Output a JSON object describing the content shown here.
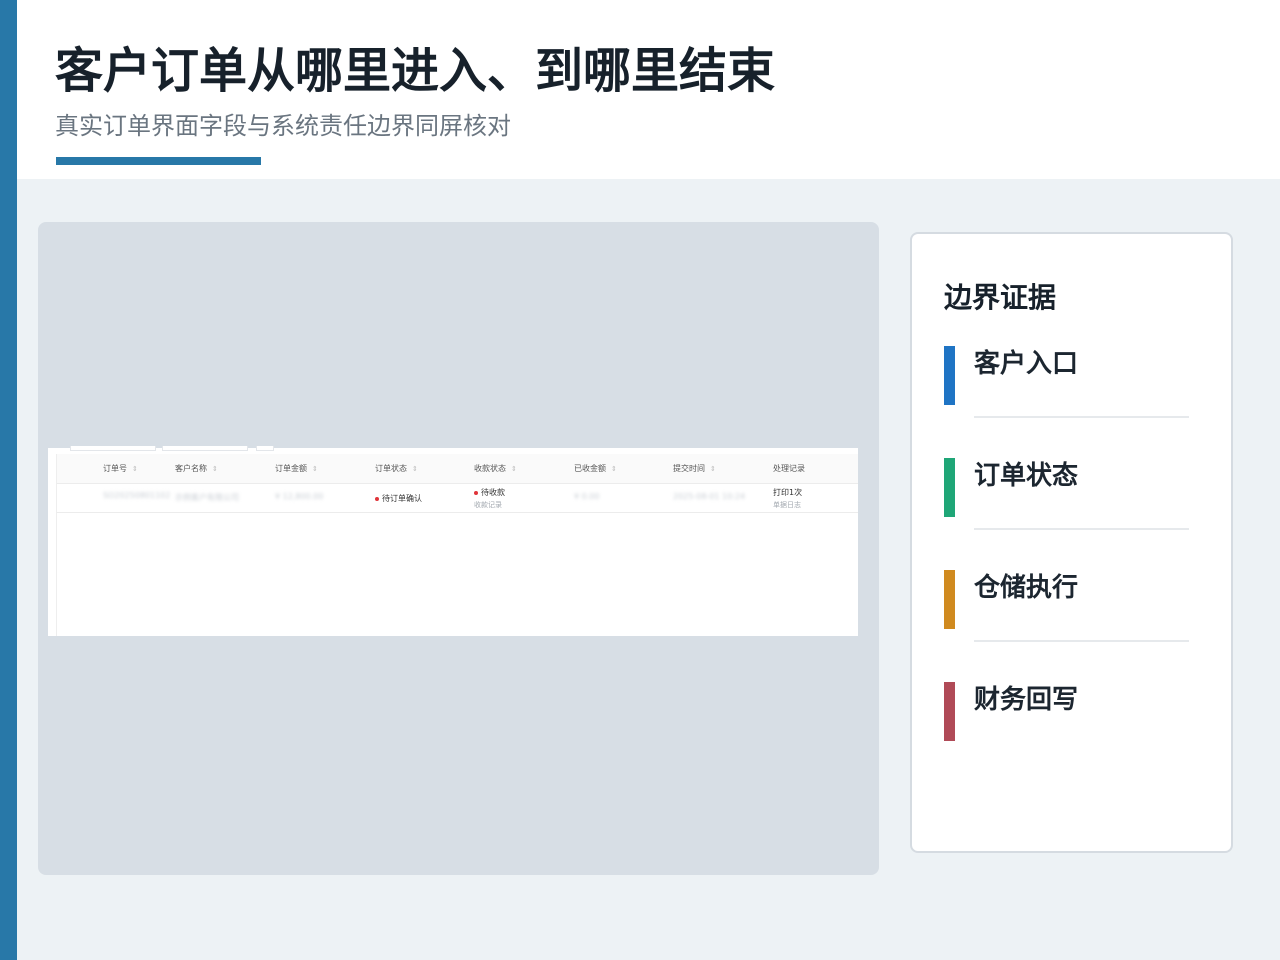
{
  "header": {
    "title": "客户订单从哪里进入、到哪里结束",
    "subtitle": "真实订单界面字段与系统责任边界同屏核对"
  },
  "colors": {
    "brand": "#2878a8",
    "entry": "#1f74c4",
    "status": "#1fa677",
    "warehouse": "#d08a1f",
    "finance": "#b04a57"
  },
  "table": {
    "columns": [
      "订单号",
      "客户名称",
      "订单金额",
      "订单状态",
      "收款状态",
      "已收金额",
      "提交时间",
      "处理记录"
    ],
    "row": {
      "order_no": "SO20250801102",
      "customer": "示例客户有限公司",
      "amount": "¥ 12,800.00",
      "order_status": "待订单确认",
      "payment_status": "待收款",
      "payment_link": "收款记录",
      "received": "¥ 0.00",
      "submitted": "2025-08-01 10:24",
      "records": "打印1次",
      "records_link": "单据日志"
    }
  },
  "evidence": {
    "title": "边界证据",
    "items": [
      {
        "label": "客户入口",
        "color": "#1f74c4"
      },
      {
        "label": "订单状态",
        "color": "#1fa677"
      },
      {
        "label": "仓储执行",
        "color": "#d08a1f"
      },
      {
        "label": "财务回写",
        "color": "#b04a57"
      }
    ]
  }
}
